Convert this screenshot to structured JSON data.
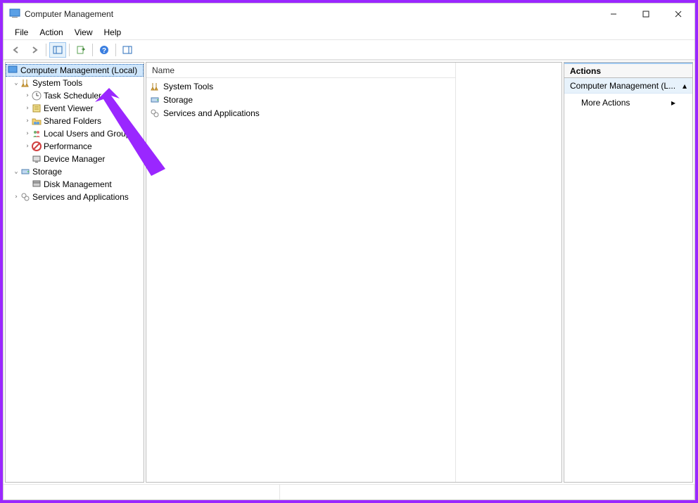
{
  "window": {
    "title": "Computer Management"
  },
  "menubar": {
    "file": "File",
    "action": "Action",
    "view": "View",
    "help": "Help"
  },
  "tree": {
    "root": "Computer Management (Local)",
    "system_tools": "System Tools",
    "task_scheduler": "Task Scheduler",
    "event_viewer": "Event Viewer",
    "shared_folders": "Shared Folders",
    "local_users": "Local Users and Groups",
    "performance": "Performance",
    "device_manager": "Device Manager",
    "storage": "Storage",
    "disk_management": "Disk Management",
    "services_apps": "Services and Applications"
  },
  "list": {
    "header": "Name",
    "items": {
      "system_tools": "System Tools",
      "storage": "Storage",
      "services_apps": "Services and Applications"
    }
  },
  "actions": {
    "title": "Actions",
    "context": "Computer Management (L...",
    "more": "More Actions"
  }
}
